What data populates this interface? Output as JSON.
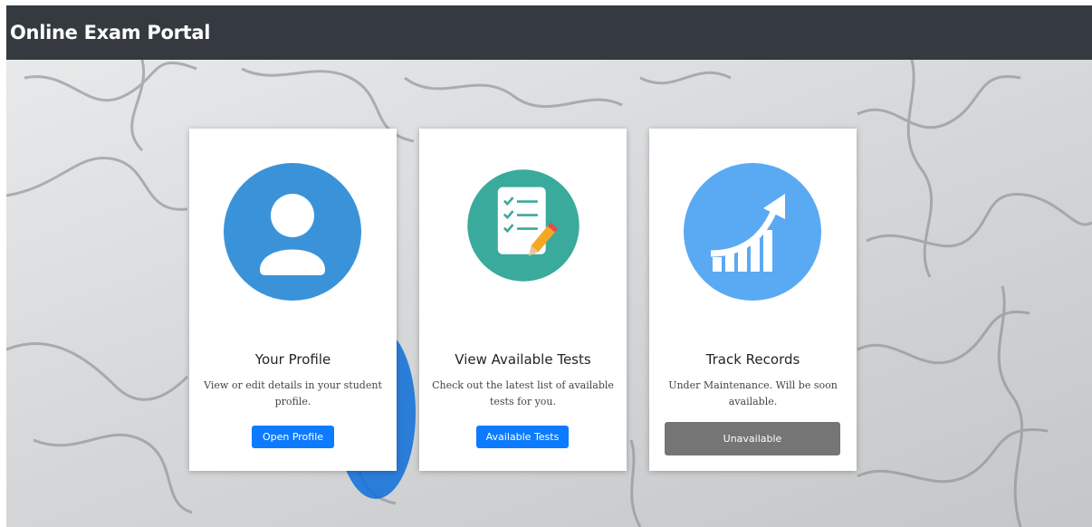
{
  "navbar": {
    "brand": "Online Exam Portal"
  },
  "cards": [
    {
      "title": "Your Profile",
      "description": "View or edit details in your student profile.",
      "button": "Open Profile",
      "icon": "user-icon",
      "icon_color": "#3a93d9"
    },
    {
      "title": "View Available Tests",
      "description": "Check out the latest list of available tests for you.",
      "button": "Available Tests",
      "icon": "checklist-icon",
      "icon_color": "#3aaa9c"
    },
    {
      "title": "Track Records",
      "description": "Under Maintenance. Will be soon available.",
      "button": "Unavailable",
      "icon": "growth-chart-icon",
      "icon_color": "#5aaaf3"
    }
  ],
  "colors": {
    "navbar": "#343a40",
    "button_primary": "#0d7bff",
    "button_disabled": "#757575"
  }
}
